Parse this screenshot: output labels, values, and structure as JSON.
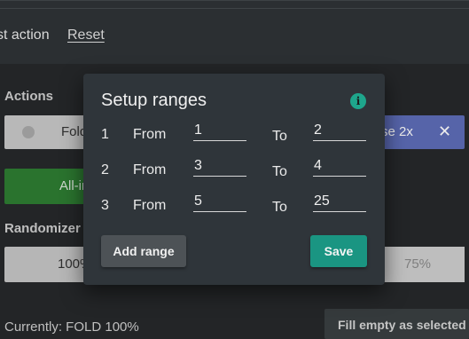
{
  "toolbar": {
    "last_action_label": "st action",
    "reset_label": "Reset"
  },
  "actions_section": {
    "label": "Actions",
    "fold_label": "Fold",
    "raise_label": "se  2x",
    "raise_close_icon": "close-icon",
    "allin_label": "All-in",
    "raise_color": "#5e6db8",
    "allin_color": "#2e7d32"
  },
  "randomizer_section": {
    "label": "Randomizer",
    "left_value": "100%",
    "right_value": "75%"
  },
  "status": {
    "currently": "Currently: FOLD 100%",
    "fill_button": "Fill empty as selected"
  },
  "modal": {
    "title": "Setup ranges",
    "info_icon": "info-icon",
    "from_label": "From",
    "to_label": "To",
    "rows": [
      {
        "index": "1",
        "from": "1",
        "to": "2"
      },
      {
        "index": "2",
        "from": "3",
        "to": "4"
      },
      {
        "index": "3",
        "from": "5",
        "to": "25"
      }
    ],
    "add_range_label": "Add range",
    "save_label": "Save",
    "save_color": "#1a9582"
  }
}
